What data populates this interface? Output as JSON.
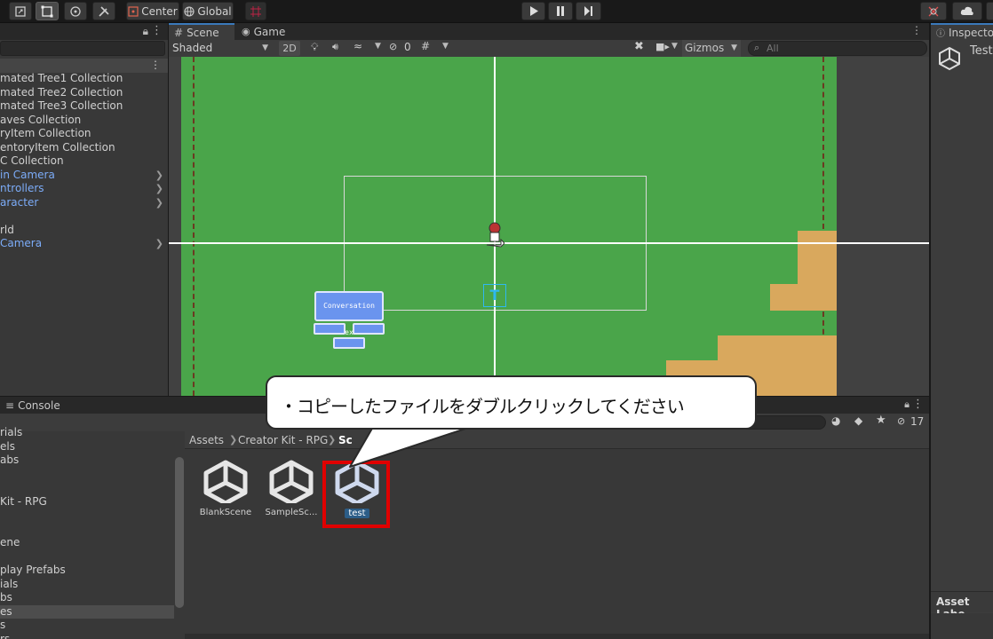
{
  "toolbar": {
    "pivot_label": "Center",
    "space_label": "Global"
  },
  "hierarchy": {
    "items": [
      {
        "label": "mated Tree1 Collection",
        "blue": false,
        "chevron": false
      },
      {
        "label": "mated Tree2 Collection",
        "blue": false,
        "chevron": false
      },
      {
        "label": "mated Tree3 Collection",
        "blue": false,
        "chevron": false
      },
      {
        "label": "aves Collection",
        "blue": false,
        "chevron": false
      },
      {
        "label": "ryItem Collection",
        "blue": false,
        "chevron": false
      },
      {
        "label": "entoryItem Collection",
        "blue": false,
        "chevron": false
      },
      {
        "label": "C Collection",
        "blue": false,
        "chevron": false
      },
      {
        "label": "in Camera",
        "blue": true,
        "chevron": true
      },
      {
        "label": "ntrollers",
        "blue": true,
        "chevron": true
      },
      {
        "label": "aracter",
        "blue": true,
        "chevron": true
      },
      {
        "label": "",
        "blue": false,
        "chevron": false
      },
      {
        "label": "rld",
        "blue": false,
        "chevron": false
      },
      {
        "label": "Camera",
        "blue": true,
        "chevron": true
      }
    ]
  },
  "scene_tabs": {
    "scene": "Scene",
    "game": "Game"
  },
  "scene_toolbar": {
    "shading": "Shaded",
    "mode_2d": "2D",
    "hidden_count": "0",
    "gizmos": "Gizmos",
    "search_placeholder": "All"
  },
  "scene_objects": {
    "conversation_text": "Conversation Text"
  },
  "inspector": {
    "tab": "Inspecto",
    "object_name": "Test",
    "asset_labels": "Asset Labe"
  },
  "console": {
    "tab": "Console",
    "hidden_count": "17"
  },
  "project": {
    "breadcrumb": [
      "Assets",
      "Creator Kit - RPG",
      "Sc"
    ],
    "left_items": [
      "rials",
      "els",
      "abs",
      "",
      "",
      "Kit - RPG",
      "",
      "",
      "ene",
      "",
      "play Prefabs",
      "ials",
      "bs",
      "es",
      "s",
      "rs"
    ],
    "selected_left_index": 13,
    "assets": [
      {
        "label": "BlankScene",
        "selected": false
      },
      {
        "label": "SampleSc...",
        "selected": false
      },
      {
        "label": "test",
        "selected": true
      }
    ]
  },
  "callout": {
    "text": "・コピーしたファイルをダブルクリックしてください"
  },
  "colors": {
    "highlight_red": "#e00000",
    "selection_blue": "#2c5d87",
    "grass": "#4aa54a",
    "sand": "#d9a85d"
  }
}
